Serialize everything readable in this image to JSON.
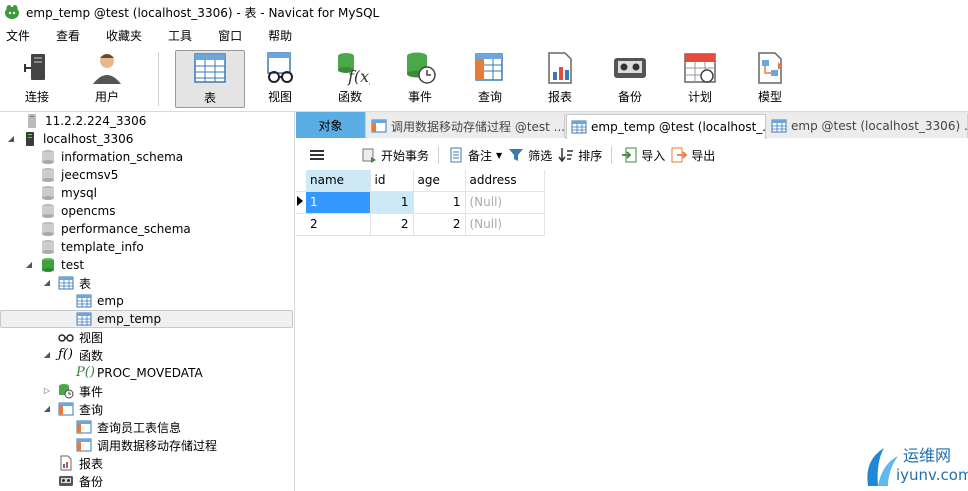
{
  "window": {
    "title": "emp_temp @test (localhost_3306) - 表 - Navicat for MySQL"
  },
  "menu": [
    "文件",
    "查看",
    "收藏夹",
    "工具",
    "窗口",
    "帮助"
  ],
  "toolbar": {
    "items": [
      {
        "label": "连接",
        "icon": "connection-icon"
      },
      {
        "label": "用户",
        "icon": "user-icon"
      },
      {
        "label": "表",
        "icon": "table-icon",
        "active": true
      },
      {
        "label": "视图",
        "icon": "view-icon"
      },
      {
        "label": "函数",
        "icon": "function-icon"
      },
      {
        "label": "事件",
        "icon": "event-icon"
      },
      {
        "label": "查询",
        "icon": "query-icon"
      },
      {
        "label": "报表",
        "icon": "report-icon"
      },
      {
        "label": "备份",
        "icon": "backup-icon"
      },
      {
        "label": "计划",
        "icon": "schedule-icon"
      },
      {
        "label": "模型",
        "icon": "model-icon"
      }
    ]
  },
  "tree": {
    "items": [
      {
        "label": "11.2.2.224_3306",
        "type": "connection-closed"
      },
      {
        "label": "localhost_3306",
        "type": "connection-open"
      },
      {
        "label": "information_schema",
        "type": "database"
      },
      {
        "label": "jeecmsv5",
        "type": "database"
      },
      {
        "label": "mysql",
        "type": "database"
      },
      {
        "label": "opencms",
        "type": "database"
      },
      {
        "label": "performance_schema",
        "type": "database"
      },
      {
        "label": "template_info",
        "type": "database"
      },
      {
        "label": "test",
        "type": "database-open"
      },
      {
        "label": "表",
        "type": "tables-folder"
      },
      {
        "label": "emp",
        "type": "table"
      },
      {
        "label": "emp_temp",
        "type": "table",
        "selected": true
      },
      {
        "label": "视图",
        "type": "views-folder"
      },
      {
        "label": "函数",
        "type": "functions-folder"
      },
      {
        "label": "PROC_MOVEDATA",
        "type": "procedure"
      },
      {
        "label": "事件",
        "type": "events-folder"
      },
      {
        "label": "查询",
        "type": "queries-folder"
      },
      {
        "label": "查询员工表信息",
        "type": "query"
      },
      {
        "label": "调用数据移动存储过程",
        "type": "query"
      },
      {
        "label": "报表",
        "type": "reports-folder"
      },
      {
        "label": "备份",
        "type": "backups-folder"
      }
    ]
  },
  "tabs": [
    {
      "label": "对象"
    },
    {
      "label": "调用数据移动存储过程 @test ..."
    },
    {
      "label": "emp_temp @test (localhost_..."
    },
    {
      "label": "emp @test (localhost_3306) ..."
    }
  ],
  "content_toolbar": {
    "begin_tx": "开始事务",
    "note": "备注",
    "filter": "筛选",
    "sort": "排序",
    "import": "导入",
    "export": "导出"
  },
  "grid": {
    "columns": [
      "name",
      "id",
      "age",
      "address"
    ],
    "rows": [
      [
        "1",
        "1",
        "1",
        "(Null)"
      ],
      [
        "2",
        "2",
        "2",
        "(Null)"
      ]
    ]
  },
  "watermark": {
    "line1": "运维网",
    "line2": "iyunv.com"
  },
  "colors": {
    "accent": "#5aaee3",
    "selected_cell": "#3399ff",
    "database_green": "#3fa23f"
  }
}
